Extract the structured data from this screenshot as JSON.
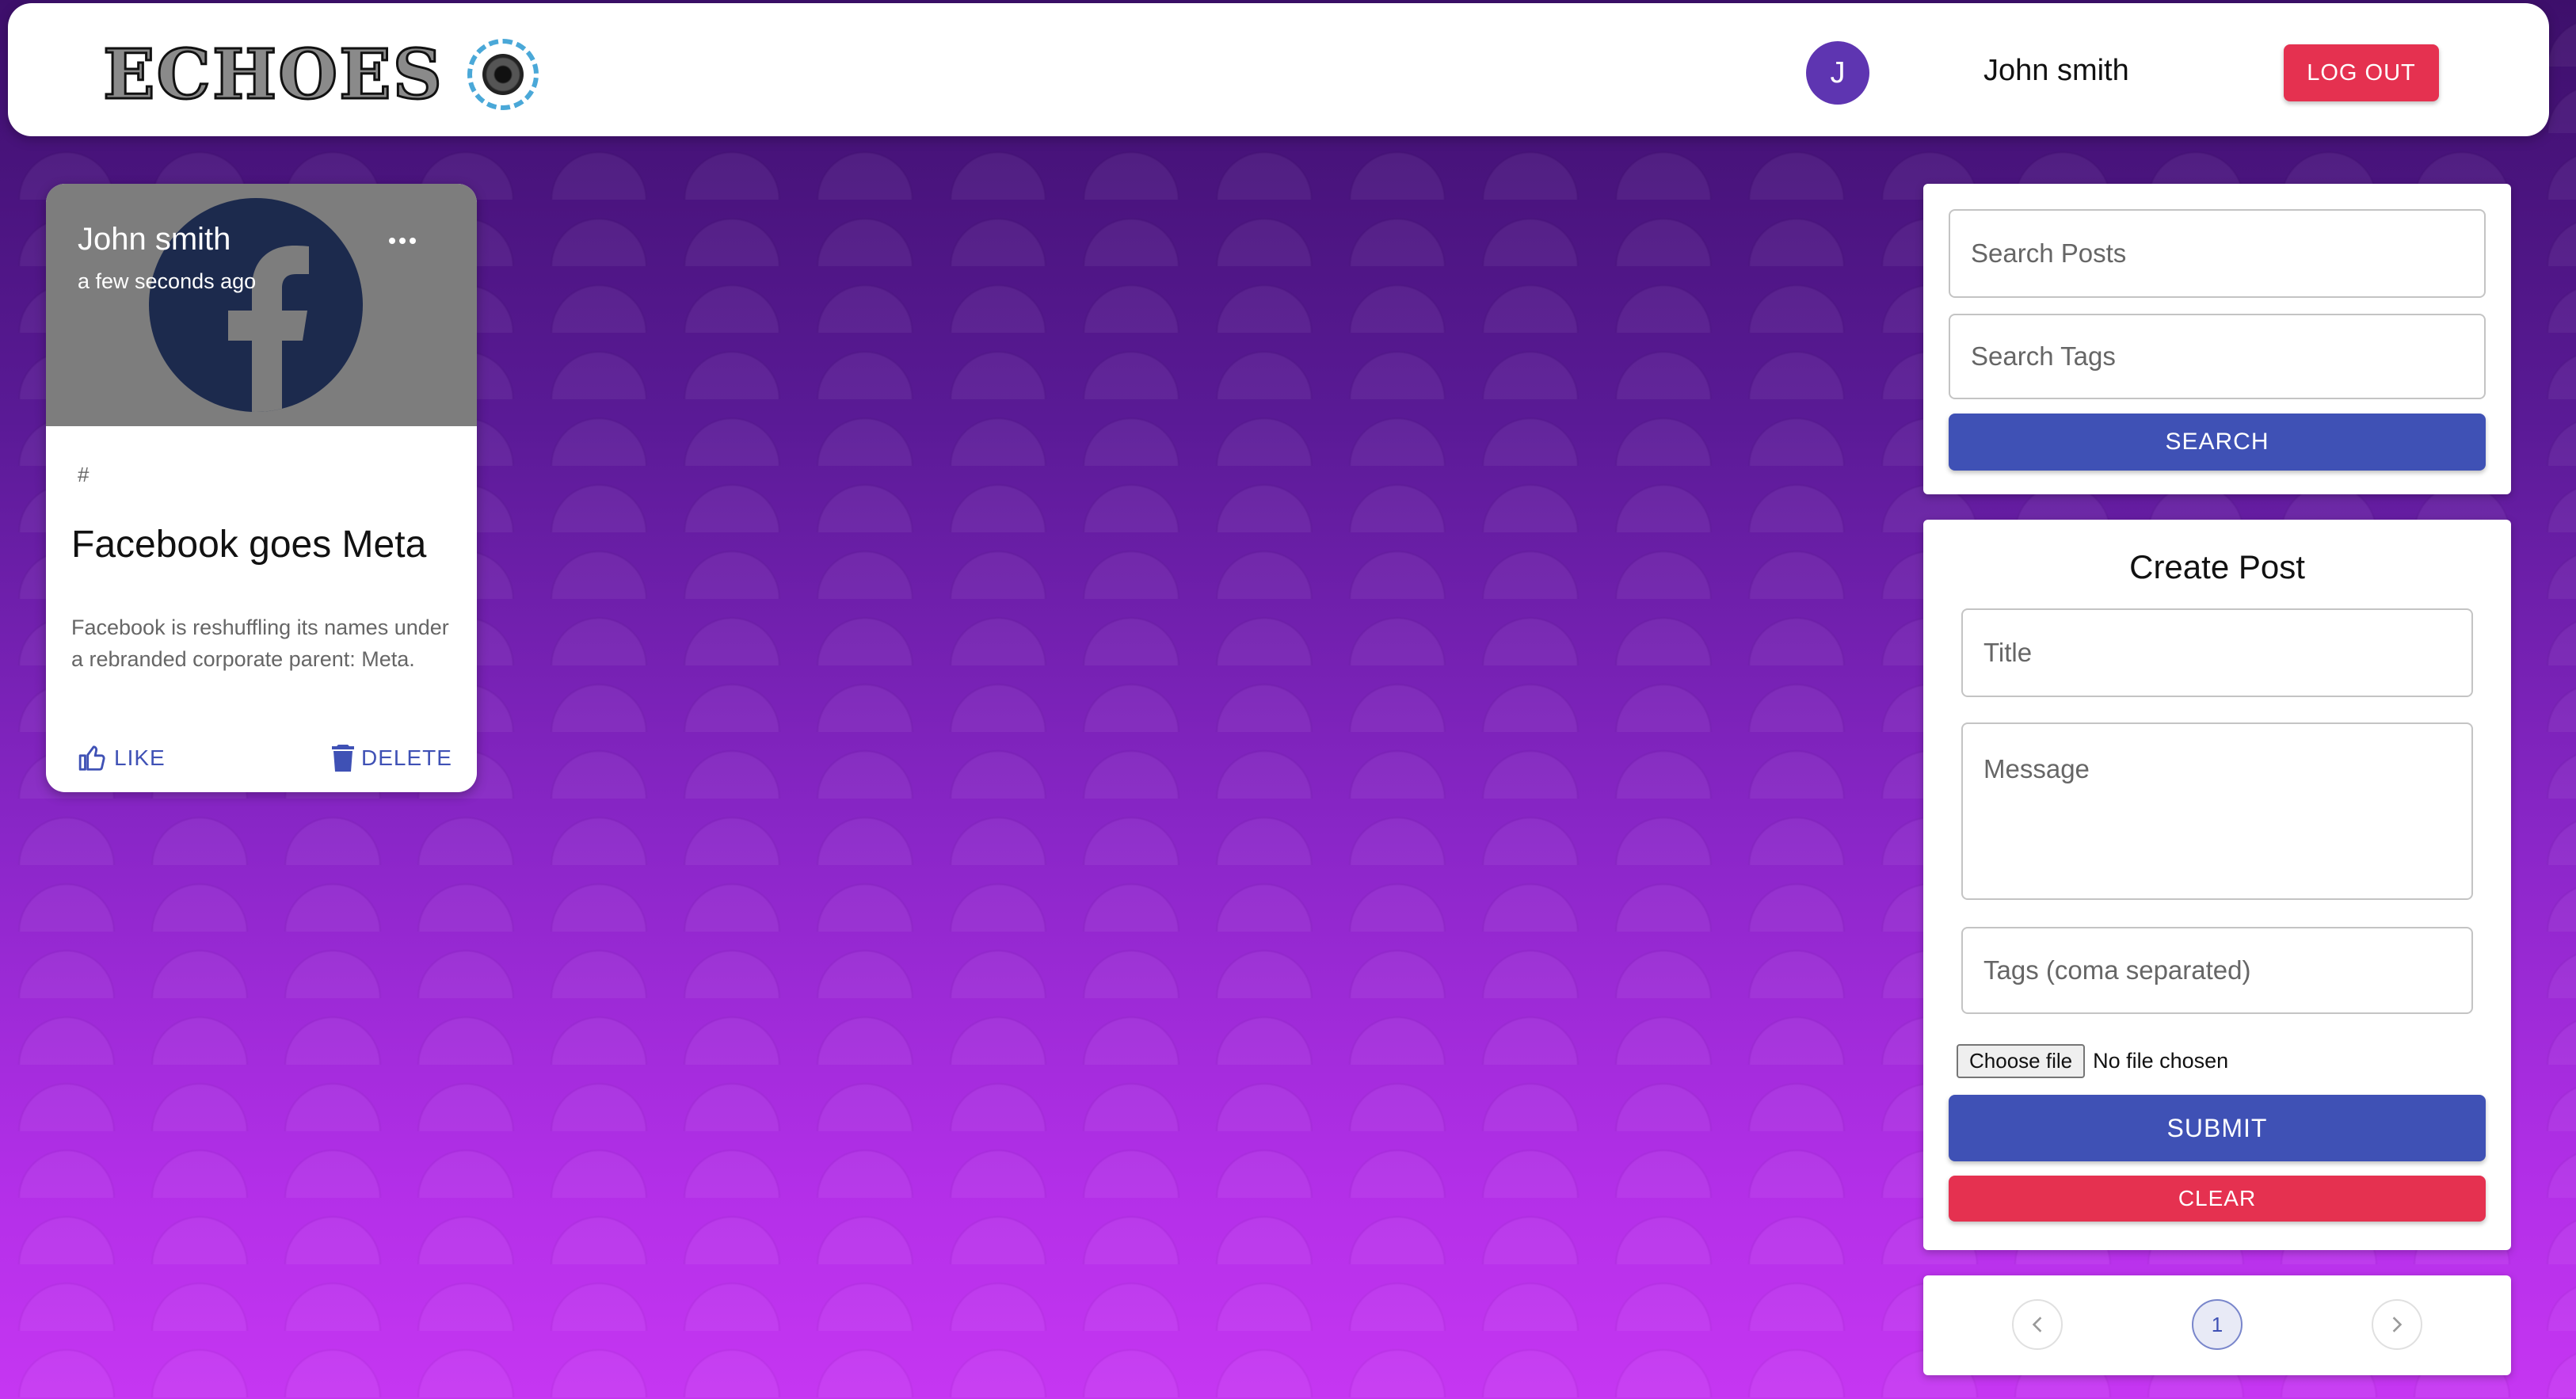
{
  "header": {
    "brand": "ECHOES",
    "avatar_initial": "J",
    "user_name": "John smith",
    "logout_label": "LOG OUT"
  },
  "post": {
    "author": "John smith",
    "time": "a few seconds ago",
    "tags": "#",
    "title": "Facebook goes Meta",
    "message": "Facebook is reshuffling its names under a rebranded corporate parent: Meta.",
    "like_label": "LIKE",
    "delete_label": "DELETE",
    "image_icon": "facebook-logo"
  },
  "search": {
    "posts_placeholder": "Search Posts",
    "tags_placeholder": "Search Tags",
    "button_label": "SEARCH"
  },
  "form": {
    "title": "Create Post",
    "title_placeholder": "Title",
    "message_placeholder": "Message",
    "tags_placeholder": "Tags (coma separated)",
    "file_button": "Choose file",
    "file_status": "No file chosen",
    "submit_label": "SUBMIT",
    "clear_label": "CLEAR"
  },
  "pagination": {
    "current_page": "1",
    "prev_icon": "chevron-left-icon",
    "next_icon": "chevron-right-icon"
  },
  "colors": {
    "primary": "#3f51b5",
    "danger": "#e53150",
    "avatar": "#5e35b1"
  }
}
